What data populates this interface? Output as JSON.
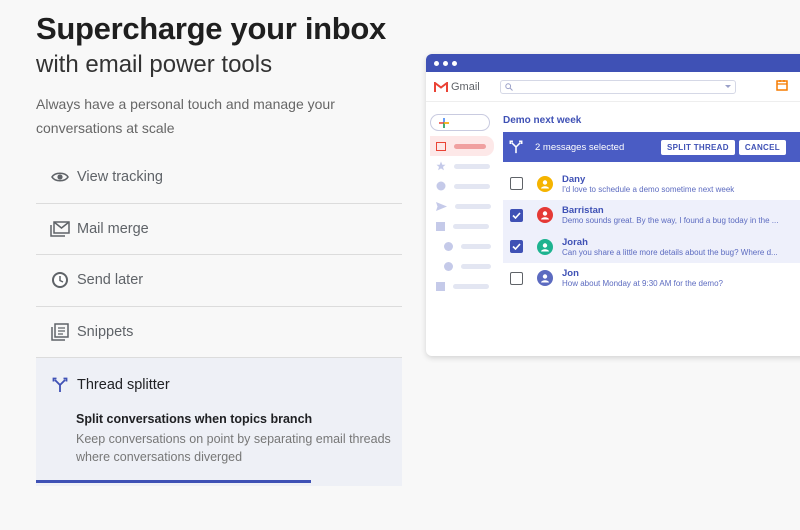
{
  "hero": {
    "title": "Supercharge your inbox",
    "subtitle": "with email power tools",
    "description": "Always have a personal touch and manage your conversations at scale"
  },
  "features": [
    {
      "label": "View tracking",
      "icon": "eye-icon"
    },
    {
      "label": "Mail merge",
      "icon": "mail-merge-icon"
    },
    {
      "label": "Send later",
      "icon": "clock-icon"
    },
    {
      "label": "Snippets",
      "icon": "snippets-icon"
    },
    {
      "label": "Thread splitter",
      "icon": "split-icon"
    }
  ],
  "active_feature": {
    "detail_title": "Split conversations when topics branch",
    "detail_desc": "Keep conversations on point by separating email threads where conversations diverged"
  },
  "progress": 0.75,
  "gmail": {
    "logo_text": "Gmail",
    "thread_title": "Demo next week",
    "selection_text": "2 messages selected",
    "split_button": "SPLIT THREAD",
    "cancel_button": "CANCEL",
    "messages": [
      {
        "name": "Dany",
        "snippet": "I'd love to schedule a demo sometime next week",
        "checked": false,
        "color": "#f5b400"
      },
      {
        "name": "Barristan",
        "snippet": "Demo sounds great. By the way, I found a bug today in the ...",
        "checked": true,
        "color": "#e53935"
      },
      {
        "name": "Jorah",
        "snippet": "Can you share a little more details about the bug? Where d...",
        "checked": true,
        "color": "#1db390"
      },
      {
        "name": "Jon",
        "snippet": "How about Monday at 9:30 AM for the demo?",
        "checked": false,
        "color": "#5c6bc0"
      }
    ]
  },
  "colors": {
    "accent": "#3f51b5",
    "selection_bar": "#4a5cc4"
  }
}
